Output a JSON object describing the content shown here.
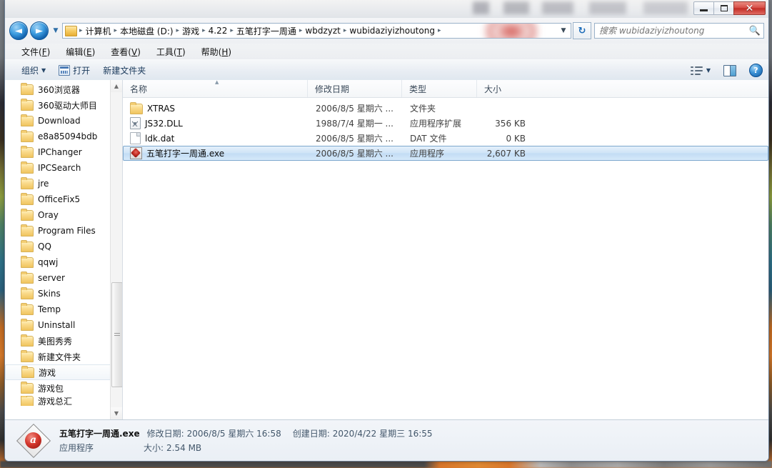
{
  "window": {
    "title_obscured": true,
    "controls": {
      "minimize": "—",
      "maximize": "▢",
      "close": "✕"
    }
  },
  "address_bar": {
    "back_icon": "◄",
    "forward_icon": "►",
    "history_icon": "▼",
    "folder_icon": "folder-icon",
    "breadcrumbs": [
      "计算机",
      "本地磁盘 (D:)",
      "游戏",
      "4.22",
      "五笔打字一周通",
      "wbdzyzt",
      "wubidaziyizhoutong"
    ],
    "separator": "▸",
    "dropdown_icon": "▼",
    "refresh_icon": "↻"
  },
  "search": {
    "placeholder": "搜索 wubidaziyizhoutong",
    "value": "",
    "icon": "search-icon"
  },
  "menubar": {
    "items": [
      {
        "text": "文件",
        "accel": "F"
      },
      {
        "text": "编辑",
        "accel": "E"
      },
      {
        "text": "查看",
        "accel": "V"
      },
      {
        "text": "工具",
        "accel": "T"
      },
      {
        "text": "帮助",
        "accel": "H"
      }
    ]
  },
  "toolbar": {
    "organize_label": "组织",
    "organize_caret": "▼",
    "open_label": "打开",
    "new_folder_label": "新建文件夹",
    "view_caret": "▼",
    "icons": {
      "view": "view-list-icon",
      "preview_pane": "preview-pane-icon",
      "help": "?"
    }
  },
  "nav_pane": {
    "items": [
      {
        "label": "360浏览器",
        "hover": false
      },
      {
        "label": "360驱动大师目",
        "hover": false
      },
      {
        "label": "Download",
        "hover": false
      },
      {
        "label": "e8a85094bdb",
        "hover": false
      },
      {
        "label": "IPChanger",
        "hover": false
      },
      {
        "label": "IPCSearch",
        "hover": false
      },
      {
        "label": "jre",
        "hover": false
      },
      {
        "label": "OfficeFix5",
        "hover": false
      },
      {
        "label": "Oray",
        "hover": false
      },
      {
        "label": "Program Files",
        "hover": false
      },
      {
        "label": "QQ",
        "hover": false
      },
      {
        "label": "qqwj",
        "hover": false
      },
      {
        "label": "server",
        "hover": false
      },
      {
        "label": "Skins",
        "hover": false
      },
      {
        "label": "Temp",
        "hover": false
      },
      {
        "label": "Uninstall",
        "hover": false
      },
      {
        "label": "美图秀秀",
        "hover": false
      },
      {
        "label": "新建文件夹",
        "hover": false
      },
      {
        "label": "游戏",
        "hover": true
      },
      {
        "label": "游戏包",
        "hover": false
      },
      {
        "label": "游戏总汇",
        "hover": false
      }
    ],
    "scroll_up_icon": "▲",
    "scroll_down_icon": "▼"
  },
  "file_list": {
    "columns": [
      {
        "key": "name",
        "label": "名称",
        "sorted": true
      },
      {
        "key": "date",
        "label": "修改日期",
        "sorted": false
      },
      {
        "key": "type",
        "label": "类型",
        "sorted": false
      },
      {
        "key": "size",
        "label": "大小",
        "sorted": false
      }
    ],
    "rows": [
      {
        "icon": "folder-icon",
        "name": "XTRAS",
        "date": "2006/8/5 星期六 ...",
        "type": "文件夹",
        "size": "",
        "selected": false
      },
      {
        "icon": "dll-icon",
        "name": "JS32.DLL",
        "date": "1988/7/4 星期一 ...",
        "type": "应用程序扩展",
        "size": "356 KB",
        "selected": false
      },
      {
        "icon": "dat-file-icon",
        "name": "ldk.dat",
        "date": "2006/8/5 星期六 ...",
        "type": "DAT 文件",
        "size": "0 KB",
        "selected": false
      },
      {
        "icon": "application-icon",
        "name": "五笔打字一周通.exe",
        "date": "2006/8/5 星期六 ...",
        "type": "应用程序",
        "size": "2,607 KB",
        "selected": true
      }
    ]
  },
  "details_pane": {
    "icon": "application-icon",
    "icon_glyph": "a",
    "file_name": "五笔打字一周通.exe",
    "modified_label": "修改日期:",
    "modified_value": "2006/8/5 星期六 16:58",
    "created_label": "创建日期:",
    "created_value": "2020/4/22 星期三 16:55",
    "type_value": "应用程序",
    "size_label": "大小:",
    "size_value": "2.54 MB"
  },
  "colors": {
    "selection_blue": "#c2dcf4",
    "selection_border": "#7da7cd",
    "close_red": "#c22d26",
    "accent_blue": "#1565b0",
    "folder_yellow": "#f0c45e"
  }
}
